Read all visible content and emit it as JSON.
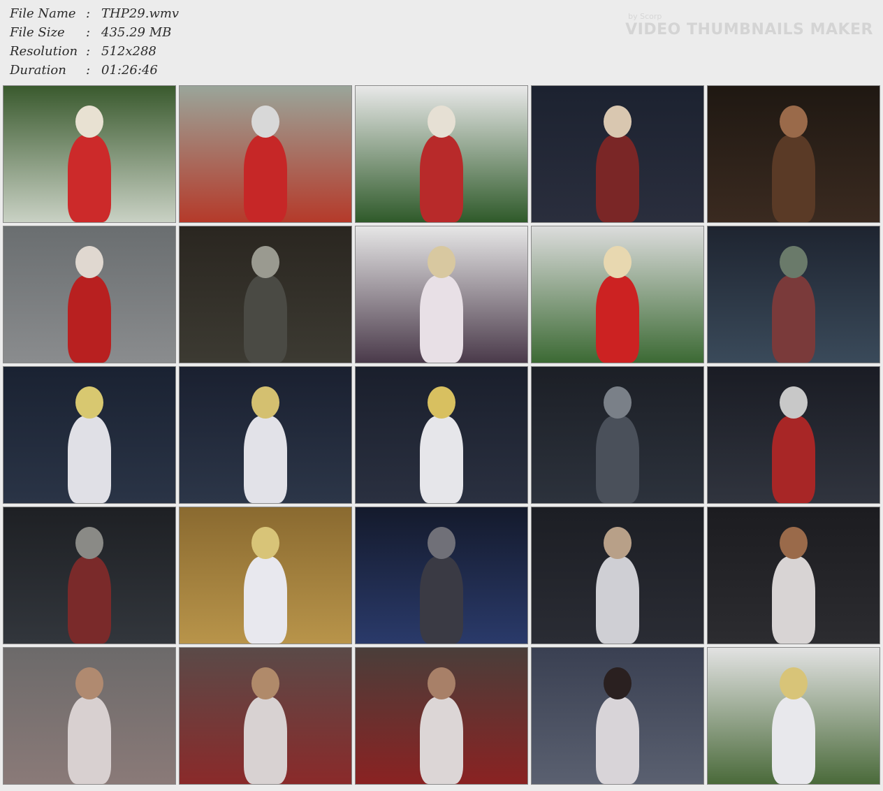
{
  "file_info": {
    "rows": [
      {
        "label": "File Name",
        "sep": ":",
        "value": "THP29.wmv"
      },
      {
        "label": "File Size",
        "sep": ":",
        "value": "435.29 MB"
      },
      {
        "label": "Resolution",
        "sep": ":",
        "value": "512x288"
      },
      {
        "label": "Duration",
        "sep": ":",
        "value": "01:26:46"
      }
    ]
  },
  "watermark": {
    "by": "by Scorp",
    "title": "VIDEO THUMBNAILS MAKER"
  },
  "thumbnails": [
    {
      "bg": "#3a5a2e",
      "bg2": "#c9d1c4",
      "fig": "#cc2a2a",
      "head": "#e8e1d2"
    },
    {
      "bg": "#9aa59a",
      "bg2": "#b53a2a",
      "fig": "#c62727",
      "head": "#d8d8d8"
    },
    {
      "bg": "#e8e8e8",
      "bg2": "#2f5a2a",
      "fig": "#b82a2a",
      "head": "#e6e0d4"
    },
    {
      "bg": "#1c2230",
      "bg2": "#2a2e3d",
      "fig": "#7a2626",
      "head": "#d9c7b0"
    },
    {
      "bg": "#1f1812",
      "bg2": "#3a2a20",
      "fig": "#5a3a26",
      "head": "#9a6a4a"
    },
    {
      "bg": "#6a6e70",
      "bg2": "#8a8c8e",
      "fig": "#b82020",
      "head": "#e0d8d0"
    },
    {
      "bg": "#2a2620",
      "bg2": "#3c3a32",
      "fig": "#4a4a44",
      "head": "#9a9a90"
    },
    {
      "bg": "#e6e6e6",
      "bg2": "#4a3a4a",
      "fig": "#e8e0e6",
      "head": "#d8c8a0"
    },
    {
      "bg": "#dcdcdc",
      "bg2": "#3c6a34",
      "fig": "#cc2222",
      "head": "#e8d8b0"
    },
    {
      "bg": "#1e2430",
      "bg2": "#3a4a5a",
      "fig": "#7a3a3a",
      "head": "#6a7a6a"
    },
    {
      "bg": "#1a2232",
      "bg2": "#2a3446",
      "fig": "#e0e0e6",
      "head": "#d8c870"
    },
    {
      "bg": "#1a2030",
      "bg2": "#2c3648",
      "fig": "#e2e2e8",
      "head": "#d4c070"
    },
    {
      "bg": "#1a1f2c",
      "bg2": "#2a3040",
      "fig": "#e6e6ea",
      "head": "#d8c060"
    },
    {
      "bg": "#1c1f26",
      "bg2": "#2c323c",
      "fig": "#4a505a",
      "head": "#7a8088"
    },
    {
      "bg": "#1a1c24",
      "bg2": "#30343e",
      "fig": "#a82626",
      "head": "#c8c8c8"
    },
    {
      "bg": "#1e2024",
      "bg2": "#32363c",
      "fig": "#7a2a2a",
      "head": "#8a8a86"
    },
    {
      "bg": "#8a6a30",
      "bg2": "#b8944a",
      "fig": "#e8e8ee",
      "head": "#d8c478"
    },
    {
      "bg": "#141a2c",
      "bg2": "#2a3a6a",
      "fig": "#3a3a44",
      "head": "#707078"
    },
    {
      "bg": "#1c1e24",
      "bg2": "#2a2c34",
      "fig": "#cfcfd4",
      "head": "#b8a088"
    },
    {
      "bg": "#1c1c20",
      "bg2": "#2c2c30",
      "fig": "#d8d4d4",
      "head": "#9a6a4a"
    },
    {
      "bg": "#6c6a6a",
      "bg2": "#8a7a78",
      "fig": "#d8d0d0",
      "head": "#b08a70"
    },
    {
      "bg": "#5a4a48",
      "bg2": "#8a2a2a",
      "fig": "#d8d2d2",
      "head": "#b08a6a"
    },
    {
      "bg": "#4a3e3a",
      "bg2": "#8a2222",
      "fig": "#dcd6d6",
      "head": "#a88068"
    },
    {
      "bg": "#3a4052",
      "bg2": "#5a6070",
      "fig": "#d8d4d8",
      "head": "#2a2020"
    },
    {
      "bg": "#e2e2e2",
      "bg2": "#4a6a3a",
      "fig": "#e8e8ec",
      "head": "#d8c478"
    }
  ]
}
